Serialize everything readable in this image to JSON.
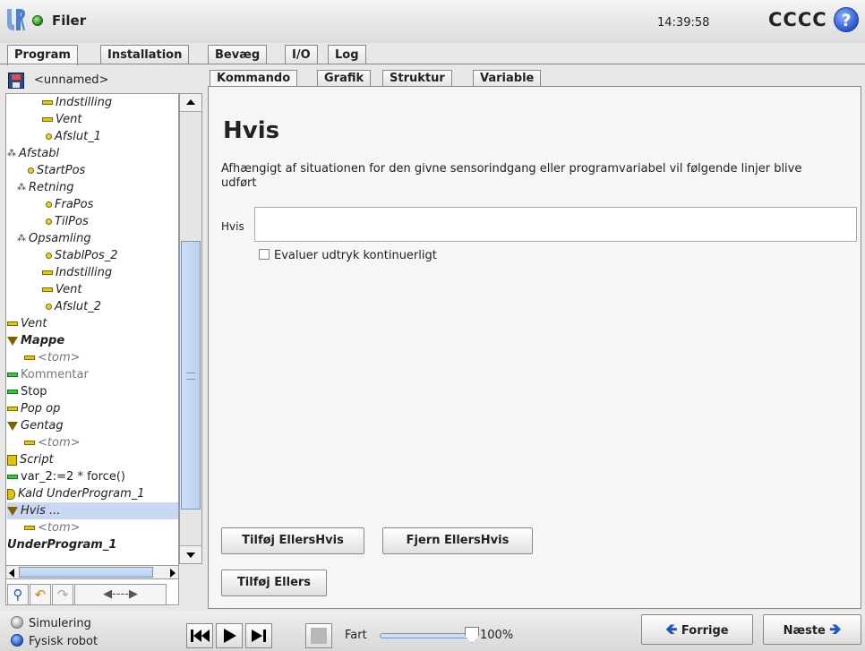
{
  "header": {
    "app_title": "Filer",
    "clock": "14:39:58",
    "robot_name": "CCCC",
    "help_glyph": "?"
  },
  "main_tabs": [
    {
      "label": "Program",
      "active": true
    },
    {
      "label": "Installation",
      "active": false
    },
    {
      "label": "Bevæg",
      "active": false
    },
    {
      "label": "I/O",
      "active": false
    },
    {
      "label": "Log",
      "active": false
    }
  ],
  "program": {
    "name": "<unnamed>"
  },
  "tree": [
    {
      "label": "Indstilling",
      "icon": "bar-icon",
      "indent": 2
    },
    {
      "label": "Vent",
      "icon": "bar-icon",
      "indent": 2
    },
    {
      "label": "Afslut_1",
      "icon": "waypoint-icon",
      "indent": 2
    },
    {
      "label": "Afstabl",
      "icon": "nodes-icon",
      "indent": 0
    },
    {
      "label": "StartPos",
      "icon": "waypoint-icon",
      "indent": 1
    },
    {
      "label": "Retning",
      "icon": "nodes-icon",
      "indent": 1
    },
    {
      "label": "FraPos",
      "icon": "waypoint-icon",
      "indent": 2
    },
    {
      "label": "TilPos",
      "icon": "waypoint-icon",
      "indent": 2
    },
    {
      "label": "Opsamling",
      "icon": "nodes-icon",
      "indent": 1
    },
    {
      "label": "StablPos_2",
      "icon": "waypoint-icon",
      "indent": 2
    },
    {
      "label": "Indstilling",
      "icon": "bar-icon",
      "indent": 2
    },
    {
      "label": "Vent",
      "icon": "bar-icon",
      "indent": 2
    },
    {
      "label": "Afslut_2",
      "icon": "waypoint-icon",
      "indent": 2
    },
    {
      "label": "Vent",
      "icon": "bar-icon",
      "indent": 0
    },
    {
      "label": "Mappe",
      "icon": "folder-triangle-icon",
      "indent": 0,
      "bold": true
    },
    {
      "label": "<tom>",
      "icon": "bar-icon",
      "indent": 1,
      "gray": true
    },
    {
      "label": "Kommentar",
      "icon": "green-bar-icon",
      "indent": 0,
      "gray": true,
      "plain": true
    },
    {
      "label": "Stop",
      "icon": "green-bar-icon",
      "indent": 0,
      "plain": true
    },
    {
      "label": "Pop op",
      "icon": "bar-icon",
      "indent": 0
    },
    {
      "label": "Gentag",
      "icon": "folder-triangle-icon",
      "indent": 0
    },
    {
      "label": "<tom>",
      "icon": "bar-icon",
      "indent": 1,
      "gray": true
    },
    {
      "label": "Script",
      "icon": "script-icon",
      "indent": 0
    },
    {
      "label": "var_2:=2 * force()",
      "icon": "green-bar-icon",
      "indent": 0,
      "plain": true
    },
    {
      "label": "Kald UnderProgram_1",
      "icon": "flag-icon",
      "indent": 0
    },
    {
      "label": "Hvis ...",
      "icon": "folder-triangle-icon",
      "indent": 0,
      "selected": true
    },
    {
      "label": "<tom>",
      "icon": "bar-icon",
      "indent": 1,
      "gray": true
    },
    {
      "label": "UnderProgram_1",
      "icon": "none",
      "indent": 0,
      "bold": true
    }
  ],
  "sub_tabs": [
    {
      "label": "Kommando",
      "active": true
    },
    {
      "label": "Grafik",
      "active": false
    },
    {
      "label": "Struktur",
      "active": false
    },
    {
      "label": "Variable",
      "active": false
    }
  ],
  "command": {
    "title": "Hvis",
    "description": "Afhængigt af situationen for den givne sensorindgang eller programvariabel vil følgende linjer blive udført",
    "if_label": "Hvis",
    "if_value": "",
    "checkbox_label": "Evaluer udtryk kontinuerligt",
    "checkbox_checked": false,
    "add_elseif_label": "Tilføj EllersHvis",
    "remove_elseif_label": "Fjern EllersHvis",
    "add_else_label": "Tilføj Ellers"
  },
  "footer": {
    "mode_simulation": "Simulering",
    "mode_physical": "Fysisk robot",
    "selected_mode": "Fysisk robot",
    "speed_label": "Fart",
    "speed_value": "100%",
    "speed_fraction": 1.0,
    "prev_label": "Forrige",
    "next_label": "Næste"
  },
  "colors": {
    "accent_blue": "#1e56c8",
    "status_green": "#1f8a14",
    "selection": "#c8d8f2"
  }
}
